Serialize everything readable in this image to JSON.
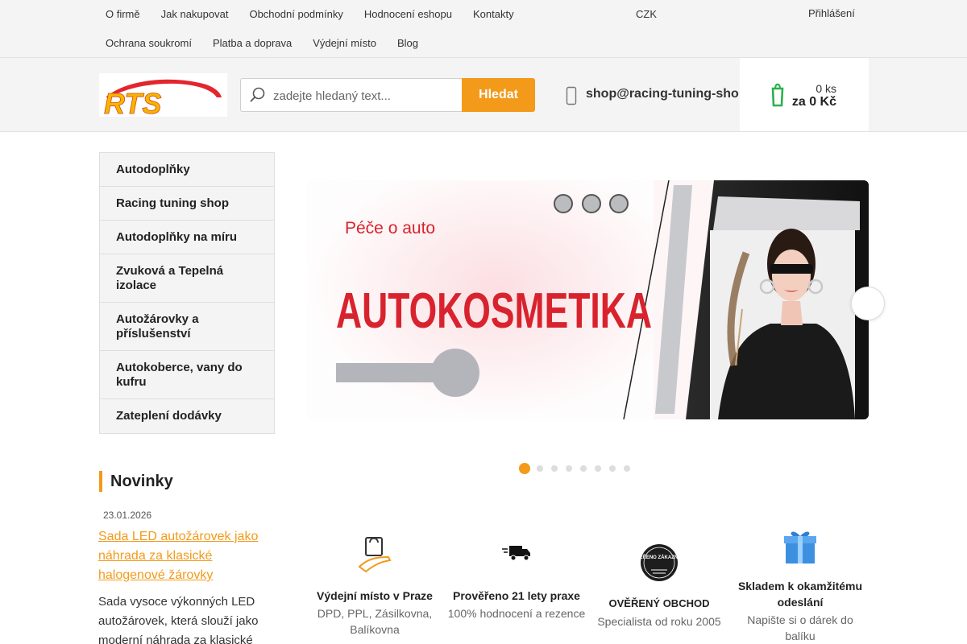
{
  "topnav": {
    "row1": [
      "O firmě",
      "Jak nakupovat",
      "Obchodní podmínky",
      "Hodnocení eshopu",
      "Kontakty"
    ],
    "row2": [
      "Ochrana soukromí",
      "Platba a doprava",
      "Výdejní místo",
      "Blog"
    ]
  },
  "currency": {
    "icon": "flag-icon",
    "label": "CZK",
    "caret": ""
  },
  "login": {
    "icon": "user-icon",
    "label": "Přihlášení"
  },
  "logo": {
    "text": "RTS"
  },
  "search": {
    "placeholder": "zadejte hledaný text...",
    "button": "Hledat"
  },
  "contact": {
    "icon": "phone-icon",
    "email": "shop@racing-tuning-shop.cz"
  },
  "cart": {
    "icon": "cart-icon",
    "count": "0 ks",
    "total": "za 0 Kč"
  },
  "menu": [
    {
      "label": "Autodoplňky",
      "arrow": ""
    },
    {
      "label": "Racing tuning shop",
      "arrow": ""
    },
    {
      "label": "Autodoplňky na míru",
      "arrow": ""
    },
    {
      "label": "Zvuková a Tepelná izolace",
      "arrow": ""
    },
    {
      "label": "Autožárovky a příslušenství",
      "arrow": ""
    },
    {
      "label": "Autokoberce, vany do kufru",
      "arrow": ""
    },
    {
      "label": "Zateplení dodávky",
      "arrow": ""
    }
  ],
  "news": {
    "heading": "Novinky",
    "date_icon": "",
    "date": "23.01.2026",
    "title": "Sada LED autožárovek jako náhrada za klasické halogenové žárovky",
    "text": "Sada vysoce výkonných LED autožárovek, která slouží jako moderní náhrada za klasické"
  },
  "banner": {
    "kicker": "Péče o auto",
    "headline": "AUTOKOSMETIKA",
    "next_icon": "",
    "slides": 8,
    "active_slide": 1
  },
  "features": [
    {
      "icon": "hand-bag-icon",
      "title": "Výdejní místo v Praze ",
      "subtitle": "DPD, PPL, Zásilkovna, Balíkovna"
    },
    {
      "icon": "truck-icon",
      "title": "Prověřeno 21 lety praxe ",
      "subtitle": "100% hodnocení a rezence"
    },
    {
      "icon": "verified-badge-icon",
      "title": "OVĚŘENÝ OBCHOD ",
      "subtitle": "Specialista od roku 2005",
      "badge_text": "OVĚŘENO ZÁKAZNÍKY"
    },
    {
      "icon": "gift-icon",
      "title": "Skladem k okamžitému odeslání ",
      "subtitle": "Napište si o dárek do balíku"
    }
  ]
}
